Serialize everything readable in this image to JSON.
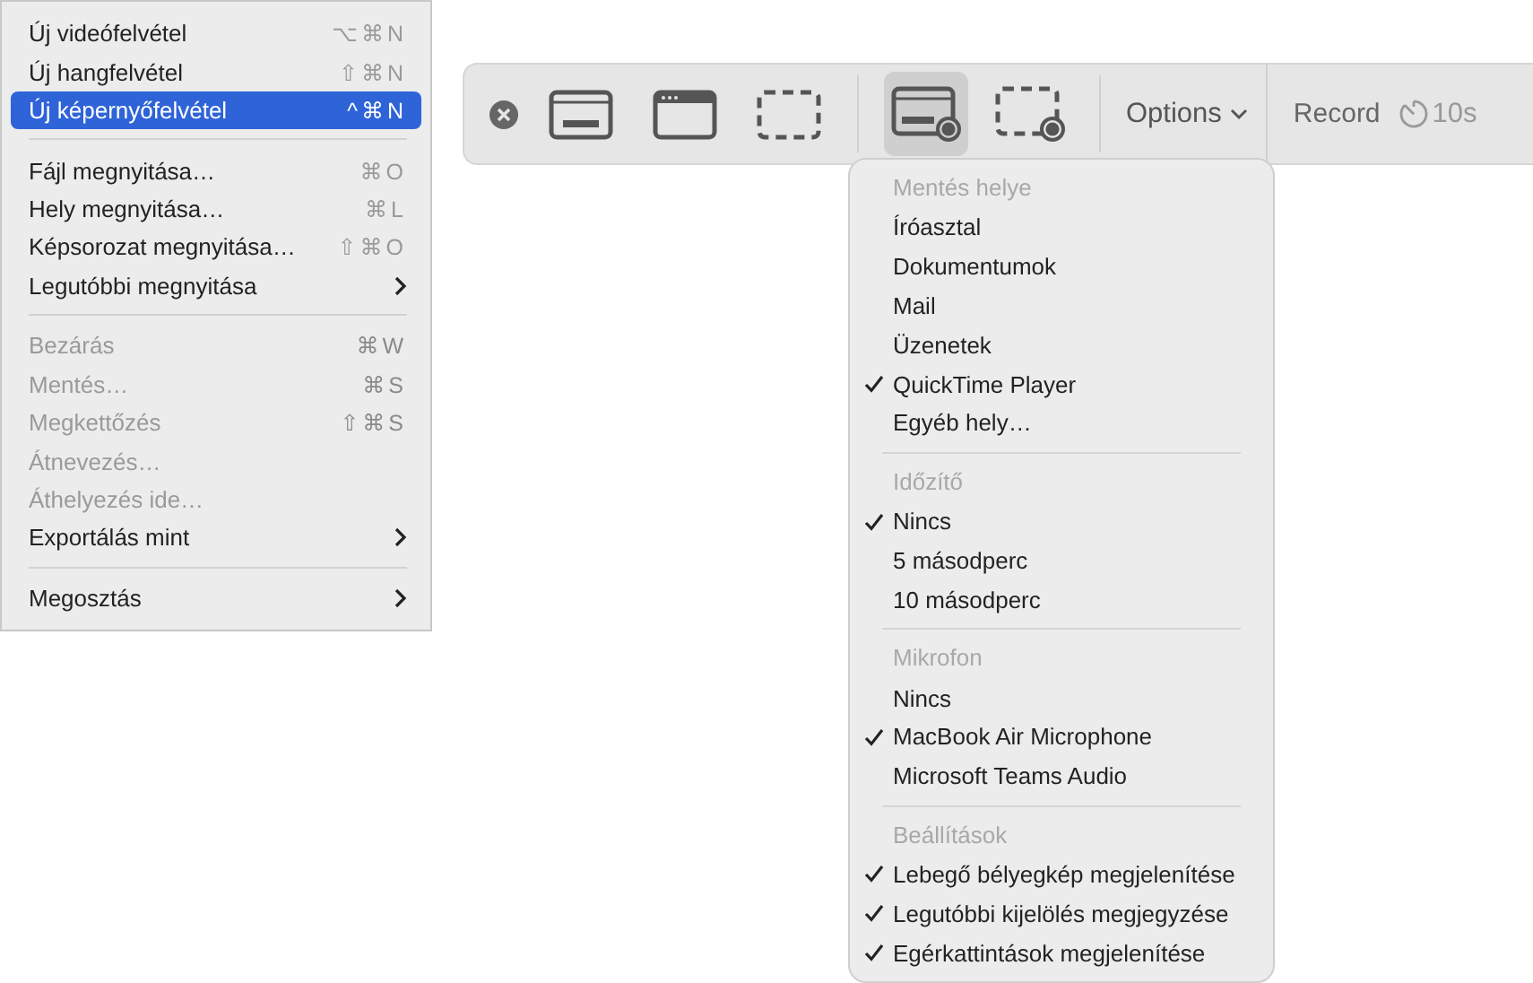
{
  "file_menu": {
    "items": [
      {
        "kind": "item",
        "label": "Új videófelvétel",
        "shortcut": "⌥⌘N",
        "disabled": false,
        "selected": false
      },
      {
        "kind": "item",
        "label": "Új hangfelvétel",
        "shortcut": "⇧⌘N",
        "disabled": false,
        "selected": false
      },
      {
        "kind": "item",
        "label": "Új képernyőfelvétel",
        "shortcut": "^⌘N",
        "disabled": false,
        "selected": true
      },
      {
        "kind": "separator"
      },
      {
        "kind": "item",
        "label": "Fájl megnyitása…",
        "shortcut": "⌘O",
        "disabled": false,
        "selected": false
      },
      {
        "kind": "item",
        "label": "Hely megnyitása…",
        "shortcut": "⌘L",
        "disabled": false,
        "selected": false
      },
      {
        "kind": "item",
        "label": "Képsorozat megnyitása…",
        "shortcut": "⇧⌘O",
        "disabled": false,
        "selected": false
      },
      {
        "kind": "submenu",
        "label": "Legutóbbi megnyitása",
        "disabled": false,
        "selected": false
      },
      {
        "kind": "separator"
      },
      {
        "kind": "item",
        "label": "Bezárás",
        "shortcut": "⌘W",
        "disabled": true,
        "selected": false
      },
      {
        "kind": "item",
        "label": "Mentés…",
        "shortcut": "⌘S",
        "disabled": true,
        "selected": false
      },
      {
        "kind": "item",
        "label": "Megkettőzés",
        "shortcut": "⇧⌘S",
        "disabled": true,
        "selected": false
      },
      {
        "kind": "item",
        "label": "Átnevezés…",
        "disabled": true,
        "selected": false
      },
      {
        "kind": "item",
        "label": "Áthelyezés ide…",
        "disabled": true,
        "selected": false
      },
      {
        "kind": "submenu",
        "label": "Exportálás mint",
        "disabled": false,
        "selected": false
      },
      {
        "kind": "separator"
      },
      {
        "kind": "submenu",
        "label": "Megosztás",
        "disabled": false,
        "selected": false
      }
    ]
  },
  "toolbar": {
    "tools": [
      {
        "kind": "close"
      },
      {
        "kind": "screen",
        "selected": false
      },
      {
        "kind": "window",
        "selected": false
      },
      {
        "kind": "selection",
        "selected": false
      },
      {
        "kind": "divider"
      },
      {
        "kind": "record-screen",
        "selected": true
      },
      {
        "kind": "record-selection",
        "selected": false
      },
      {
        "kind": "divider"
      }
    ],
    "options_button": {
      "label": "Options"
    },
    "record_button": {
      "label": "Record",
      "timer": "10s"
    }
  },
  "options_menu": {
    "sections": [
      {
        "header": "Mentés helye",
        "items": [
          {
            "label": "Íróasztal",
            "checked": false
          },
          {
            "label": "Dokumentumok",
            "checked": false
          },
          {
            "label": "Mail",
            "checked": false
          },
          {
            "label": "Üzenetek",
            "checked": false
          },
          {
            "label": "QuickTime Player",
            "checked": true
          },
          {
            "label": "Egyéb hely…",
            "checked": false
          }
        ]
      },
      {
        "header": "Időzítő",
        "items": [
          {
            "label": "Nincs",
            "checked": true
          },
          {
            "label": "5 másodperc",
            "checked": false
          },
          {
            "label": "10 másodperc",
            "checked": false
          }
        ]
      },
      {
        "header": "Mikrofon",
        "items": [
          {
            "label": "Nincs",
            "checked": false
          },
          {
            "label": "MacBook Air Microphone",
            "checked": true
          },
          {
            "label": "Microsoft Teams Audio",
            "checked": false
          }
        ]
      },
      {
        "header": "Beállítások",
        "items": [
          {
            "label": "Lebegő bélyegkép megjelenítése",
            "checked": true
          },
          {
            "label": "Legutóbbi kijelölés megjegyzése",
            "checked": true
          },
          {
            "label": "Egérkattintások megjelenítése",
            "checked": true
          }
        ]
      }
    ]
  }
}
